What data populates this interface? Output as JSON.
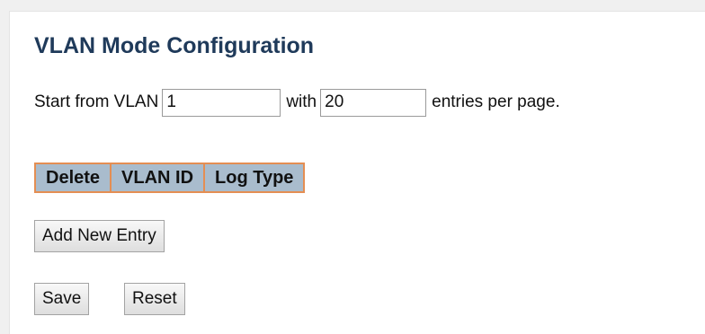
{
  "page": {
    "title": "VLAN Mode Configuration"
  },
  "paging": {
    "start_label": "Start from VLAN",
    "start_value": "1",
    "with_label": "with",
    "entries_value": "20",
    "suffix_label": "entries per page."
  },
  "table": {
    "columns": [
      "Delete",
      "VLAN ID",
      "Log Type"
    ]
  },
  "buttons": {
    "add_new_entry": "Add New Entry",
    "save": "Save",
    "reset": "Reset"
  },
  "colors": {
    "header_fill": "#a9bccd",
    "header_border": "#e48e53",
    "title_text": "#1f3a5a"
  }
}
